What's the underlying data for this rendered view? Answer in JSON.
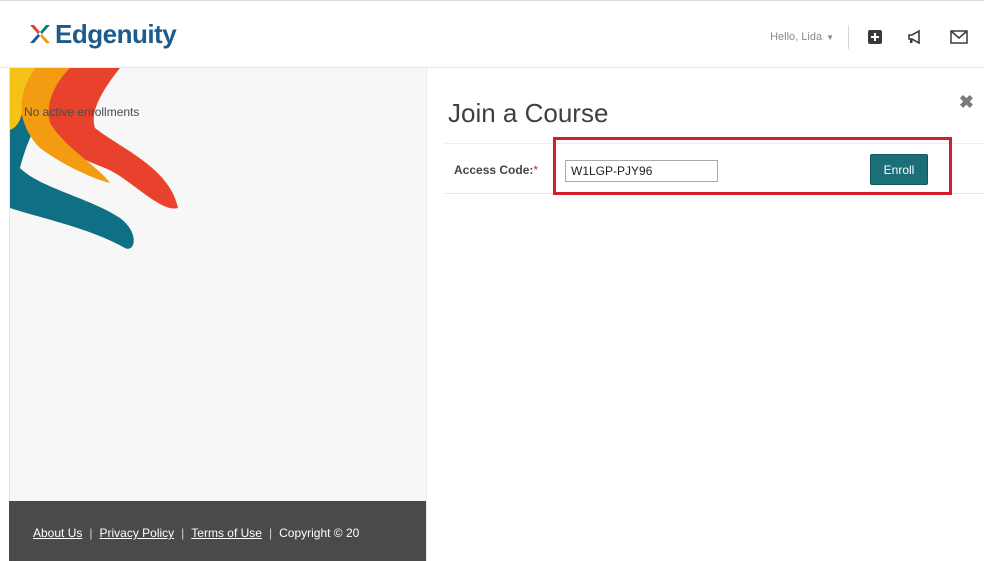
{
  "header": {
    "logo_text": "Edgenuity",
    "user_greeting": "Hello, Lida",
    "icons": [
      "plus-square-icon",
      "megaphone-icon",
      "envelope-icon"
    ]
  },
  "left": {
    "empty_message": "No active enrollments"
  },
  "footer": {
    "links": [
      "About Us",
      "Privacy Policy",
      "Terms of Use"
    ],
    "copyright": "Copyright © 20"
  },
  "modal": {
    "title": "Join a Course",
    "access_code_label": "Access Code:",
    "required_marker": "*",
    "access_code_value": "W1LGP-PJY96",
    "enroll_label": "Enroll",
    "close_symbol": "✖"
  },
  "colors": {
    "brand_blue": "#1d5a8e",
    "enroll_teal": "#1c6e78",
    "highlight_red": "#d21f2b",
    "footer_gray": "#4a4a4a"
  }
}
